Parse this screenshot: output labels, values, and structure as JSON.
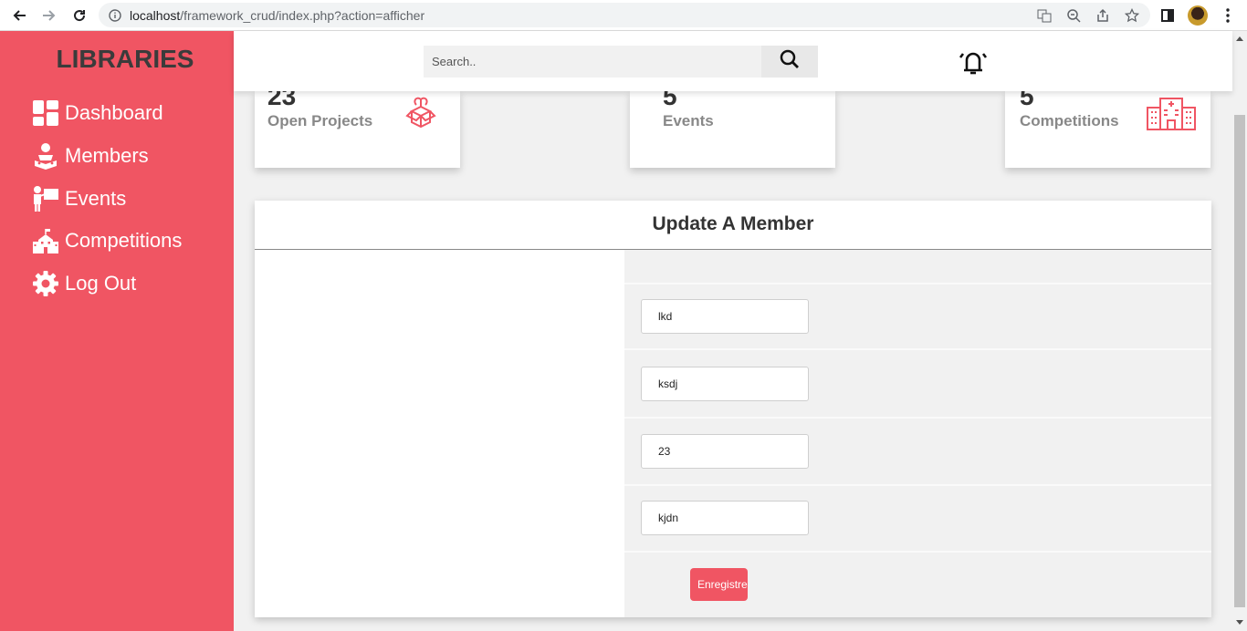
{
  "browser": {
    "url_host": "localhost",
    "url_path": "/framework_crud/index.php?action=afficher"
  },
  "sidebar": {
    "brand": "LIBRARIES",
    "items": [
      {
        "label": "Dashboard",
        "icon": "dashboard-icon"
      },
      {
        "label": "Members",
        "icon": "reader-icon"
      },
      {
        "label": "Events",
        "icon": "presenter-icon"
      },
      {
        "label": "Competitions",
        "icon": "school-icon"
      },
      {
        "label": "Log Out",
        "icon": "gear-icon"
      }
    ]
  },
  "topbar": {
    "search_placeholder": "Search..",
    "search_icon": "search-icon",
    "bell_icon": "alarm-bell-icon"
  },
  "cards": [
    {
      "number": "23",
      "label": "Open Projects",
      "icon": "open-box-icon"
    },
    {
      "number": "5",
      "label": "Events",
      "icon": ""
    },
    {
      "number": "5",
      "label": "Competitions",
      "icon": "building-icon"
    }
  ],
  "form": {
    "title": "Update A Member",
    "fields": [
      {
        "value": "lkd"
      },
      {
        "value": "ksdj"
      },
      {
        "value": "23"
      },
      {
        "value": "kjdn"
      }
    ],
    "submit_label": "Enregistrer"
  },
  "colors": {
    "accent": "#f05563",
    "sidebar_text": "#ffffff",
    "brand_text": "#3b3b3b"
  }
}
